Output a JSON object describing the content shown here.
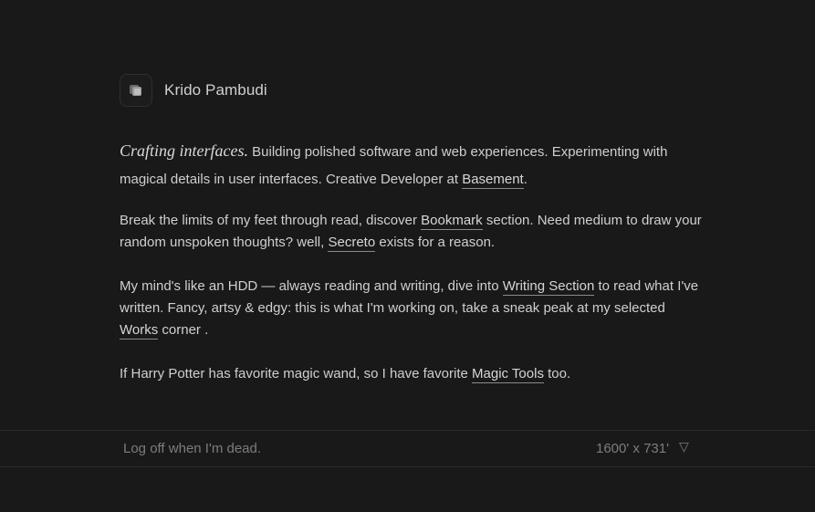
{
  "header": {
    "name": "Krido Pambudi",
    "logo_icon": "cube-icon"
  },
  "intro": {
    "italic_lead": "Crafting interfaces.",
    "text_1": " Building polished software and web experiences. Experimenting with magical details in user interfaces. Creative Developer at ",
    "link_basement": "Basement",
    "text_2": "."
  },
  "para2": {
    "text_1": "Break the limits of my feet through read, discover ",
    "link_bookmark": "Bookmark",
    "text_2": " section. Need medium to draw your random unspoken thoughts? well, ",
    "link_secreto": "Secreto",
    "text_3": " exists for a reason."
  },
  "para3": {
    "text_1": "My mind's like an HDD — always reading and writing, dive into ",
    "link_writing": "Writing Section",
    "text_2": " to read what I've written. Fancy, artsy & edgy: this is what I'm working on, take a sneak peak at my selected ",
    "link_works": "Works",
    "text_3": " corner ."
  },
  "para4": {
    "text_1": "If Harry Potter has favorite magic wand, so I have favorite ",
    "link_magic": "Magic Tools",
    "text_2": " too."
  },
  "footer": {
    "tagline": "Log off when I'm dead.",
    "dimensions": "1600' x 731'",
    "triangle_glyph": "▽"
  },
  "colors": {
    "background": "#191919",
    "text": "#cfcfcf",
    "muted": "#7d7d7d",
    "border": "#2a2a2a"
  }
}
